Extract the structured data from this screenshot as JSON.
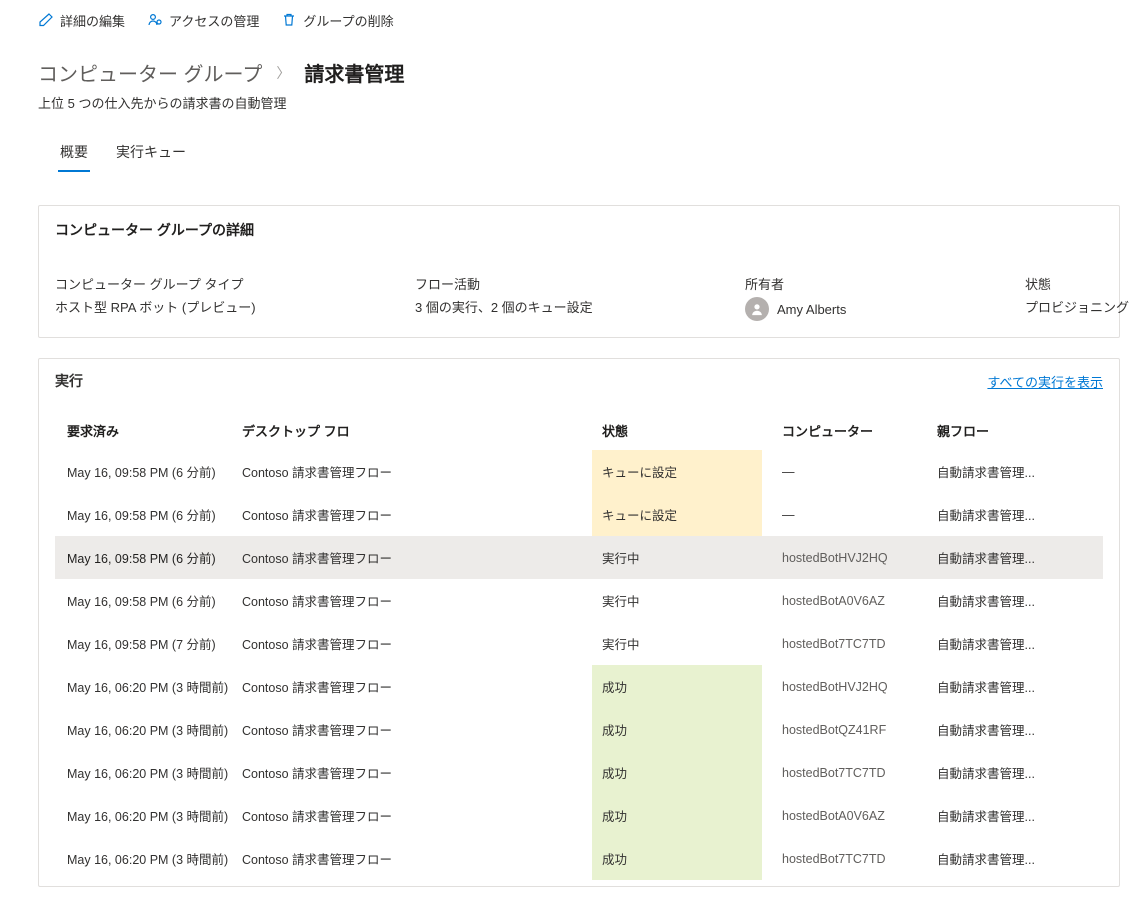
{
  "toolbar": {
    "edit": "詳細の編集",
    "access": "アクセスの管理",
    "delete": "グループの削除"
  },
  "breadcrumb": {
    "parent": "コンピューター グループ",
    "current": "請求書管理"
  },
  "subtitle": "上位 5 つの仕入先からの請求書の自動管理",
  "tabs": {
    "overview": "概要",
    "queue": "実行キュー"
  },
  "details": {
    "panel_title": "コンピューター グループの詳細",
    "type_label": "コンピューター グループ タイプ",
    "type_value": "ホスト型 RPA ボット (プレビュー)",
    "flow_label": "フロー活動",
    "flow_value": "3 個の実行、2 個のキュー設定",
    "owner_label": "所有者",
    "owner_value": "Amy Alberts",
    "state_label": "状態",
    "state_value": "プロビジョニング中"
  },
  "runs": {
    "panel_title": "実行",
    "show_all": "すべての実行を表示",
    "columns": {
      "requested": "要求済み",
      "flow": "デスクトップ フロ",
      "status": "状態",
      "computer": "コンピューター",
      "parent": "親フロー"
    },
    "status_labels": {
      "queued": "キューに設定",
      "running": "実行中",
      "success": "成功"
    },
    "rows": [
      {
        "requested": "May 16, 09:58 PM (6 分前)",
        "flow": "Contoso 請求書管理フロー",
        "status": "queued",
        "computer": "—",
        "parent": "自動請求書管理..."
      },
      {
        "requested": "May 16, 09:58 PM (6 分前)",
        "flow": "Contoso 請求書管理フロー",
        "status": "queued",
        "computer": "—",
        "parent": "自動請求書管理..."
      },
      {
        "requested": "May 16, 09:58 PM (6 分前)",
        "flow": "Contoso 請求書管理フロー",
        "status": "running",
        "computer": "hostedBotHVJ2HQ",
        "parent": "自動請求書管理...",
        "selected": true
      },
      {
        "requested": "May 16, 09:58 PM (6 分前)",
        "flow": "Contoso 請求書管理フロー",
        "status": "running",
        "computer": "hostedBotA0V6AZ",
        "parent": "自動請求書管理..."
      },
      {
        "requested": "May 16, 09:58 PM (7 分前)",
        "flow": "Contoso 請求書管理フロー",
        "status": "running",
        "computer": "hostedBot7TC7TD",
        "parent": "自動請求書管理..."
      },
      {
        "requested": "May 16, 06:20 PM (3 時間前)",
        "flow": "Contoso 請求書管理フロー",
        "status": "success",
        "computer": "hostedBotHVJ2HQ",
        "parent": "自動請求書管理..."
      },
      {
        "requested": "May 16, 06:20 PM (3 時間前)",
        "flow": "Contoso 請求書管理フロー",
        "status": "success",
        "computer": "hostedBotQZ41RF",
        "parent": "自動請求書管理..."
      },
      {
        "requested": "May 16, 06:20 PM (3 時間前)",
        "flow": "Contoso 請求書管理フロー",
        "status": "success",
        "computer": "hostedBot7TC7TD",
        "parent": "自動請求書管理..."
      },
      {
        "requested": "May 16, 06:20 PM (3 時間前)",
        "flow": "Contoso 請求書管理フロー",
        "status": "success",
        "computer": "hostedBotA0V6AZ",
        "parent": "自動請求書管理..."
      },
      {
        "requested": "May 16, 06:20 PM (3 時間前)",
        "flow": "Contoso 請求書管理フロー",
        "status": "success",
        "computer": "hostedBot7TC7TD",
        "parent": "自動請求書管理..."
      }
    ]
  }
}
